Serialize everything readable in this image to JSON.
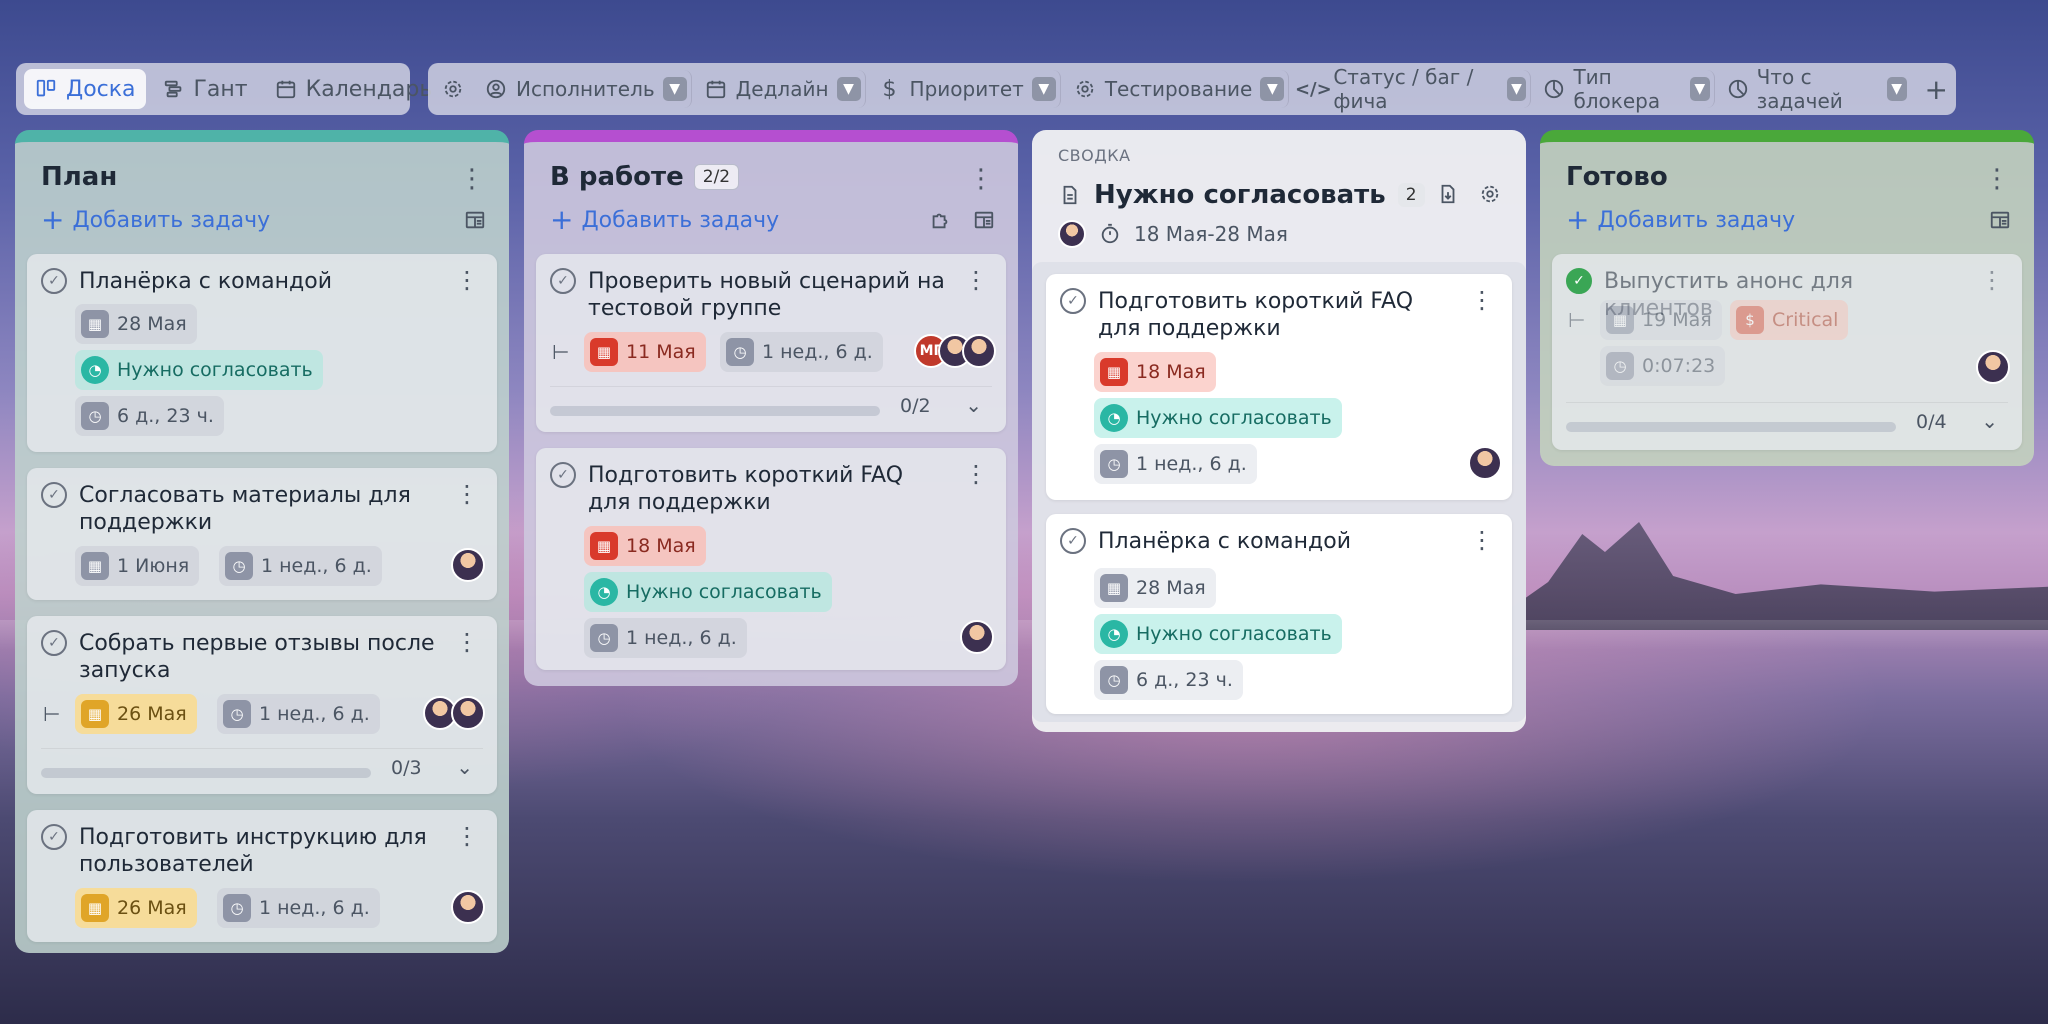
{
  "views": [
    {
      "label": "Доска",
      "icon": "board-icon",
      "active": true
    },
    {
      "label": "Гант",
      "icon": "gantt-icon",
      "active": false
    },
    {
      "label": "Календарь",
      "icon": "calendar-icon",
      "active": false
    }
  ],
  "filters": [
    {
      "label": "Исполнитель",
      "icon": "user-icon"
    },
    {
      "label": "Дедлайн",
      "icon": "calendar-icon"
    },
    {
      "label": "Приоритет",
      "icon": "dollar-icon"
    },
    {
      "label": "Тестирование",
      "icon": "gear-icon"
    },
    {
      "label": "Статус / баг / фича",
      "icon": "code-icon"
    },
    {
      "label": "Тип блокера",
      "icon": "pie-icon"
    },
    {
      "label": "Что с задачей",
      "icon": "pie-icon"
    }
  ],
  "columns": {
    "plan": {
      "title": "План",
      "add_task": "Добавить задачу",
      "cards": [
        {
          "title": "Планёрка с командой",
          "date": "28 Мая",
          "status": "Нужно согласовать",
          "time": "6 д., 23 ч."
        },
        {
          "title": "Согласовать материалы для поддержки",
          "date": "1 Июня",
          "time": "1 нед., 6 д."
        },
        {
          "title": "Собрать первые отзывы после запуска",
          "date": "26 Мая",
          "time": "1 нед., 6 д.",
          "progress": "0/3"
        },
        {
          "title": "Подготовить инструкцию для пользователей",
          "date": "26 Мая",
          "time": "1 нед., 6 д."
        }
      ]
    },
    "work": {
      "title": "В работе",
      "count": "2/2",
      "add_task": "Добавить задачу",
      "cards": [
        {
          "title": "Проверить новый сценарий на тестовой группе",
          "date": "11 Мая",
          "time": "1 нед., 6 д.",
          "progress": "0/2",
          "avatar_initials": "МГ"
        },
        {
          "title": "Подготовить короткий FAQ для поддержки",
          "date": "18 Мая",
          "status": "Нужно согласовать",
          "time": "1 нед., 6 д."
        }
      ]
    },
    "summary": {
      "label": "СВОДКА",
      "title": "Нужно согласовать",
      "count": "2",
      "range": "18 Мая-28 Мая",
      "cards": [
        {
          "title": "Подготовить короткий FAQ для поддержки",
          "date": "18 Мая",
          "status": "Нужно согласовать",
          "time": "1 нед., 6 д."
        },
        {
          "title": "Планёрка с командой",
          "date": "28 Мая",
          "status": "Нужно согласовать",
          "time": "6 д., 23 ч."
        }
      ]
    },
    "done": {
      "title": "Готово",
      "add_task": "Добавить задачу",
      "cards": [
        {
          "title": "Выпустить анонс для клиентов",
          "date": "19 Мая",
          "priority": "Critical",
          "time": "0:07:23",
          "progress": "0/4"
        }
      ]
    }
  },
  "colors": {
    "accent": "#3b6fd8",
    "plan": "#4fb3a8",
    "work": "#b54fd0",
    "done": "#4aa83a",
    "overdue": "#d93a2b",
    "soon": "#e0a528",
    "status_teal": "#2ab7a4"
  }
}
